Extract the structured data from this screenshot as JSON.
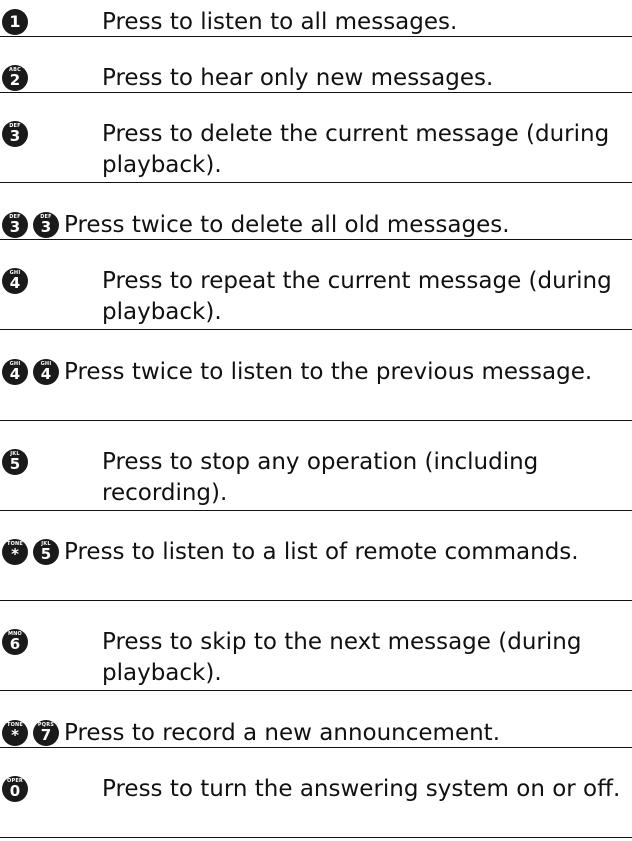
{
  "commands": [
    {
      "keys": [
        {
          "digit": "1",
          "letters": ""
        }
      ],
      "text": "Press to listen to all messages."
    },
    {
      "keys": [
        {
          "digit": "2",
          "letters": "ABC"
        }
      ],
      "text": "Press to hear only new messages."
    },
    {
      "keys": [
        {
          "digit": "3",
          "letters": "DEF"
        }
      ],
      "text": "Press to delete the current message (during playback)."
    },
    {
      "keys": [
        {
          "digit": "3",
          "letters": "DEF"
        },
        {
          "digit": "3",
          "letters": "DEF"
        }
      ],
      "text": "Press twice to delete all old messages."
    },
    {
      "keys": [
        {
          "digit": "4",
          "letters": "GHI"
        }
      ],
      "text": "Press to repeat the current message (during playback)."
    },
    {
      "keys": [
        {
          "digit": "4",
          "letters": "GHI"
        },
        {
          "digit": "4",
          "letters": "GHI"
        }
      ],
      "text": "Press twice to listen to the previous message."
    },
    {
      "keys": [
        {
          "digit": "5",
          "letters": "JKL"
        }
      ],
      "text": "Press to stop any operation (including recording)."
    },
    {
      "keys": [
        {
          "digit": "*",
          "letters": "TONE"
        },
        {
          "digit": "5",
          "letters": "JKL"
        }
      ],
      "text": "Press to listen to a list of remote commands."
    },
    {
      "keys": [
        {
          "digit": "6",
          "letters": "MNO"
        }
      ],
      "text": "Press to skip to the next message (during playback)."
    },
    {
      "keys": [
        {
          "digit": "*",
          "letters": "TONE"
        },
        {
          "digit": "7",
          "letters": "PQRS"
        }
      ],
      "text": "Press to record a new announcement."
    },
    {
      "keys": [
        {
          "digit": "0",
          "letters": "OPER"
        }
      ],
      "text": "Press to turn the answering system on or off."
    }
  ]
}
